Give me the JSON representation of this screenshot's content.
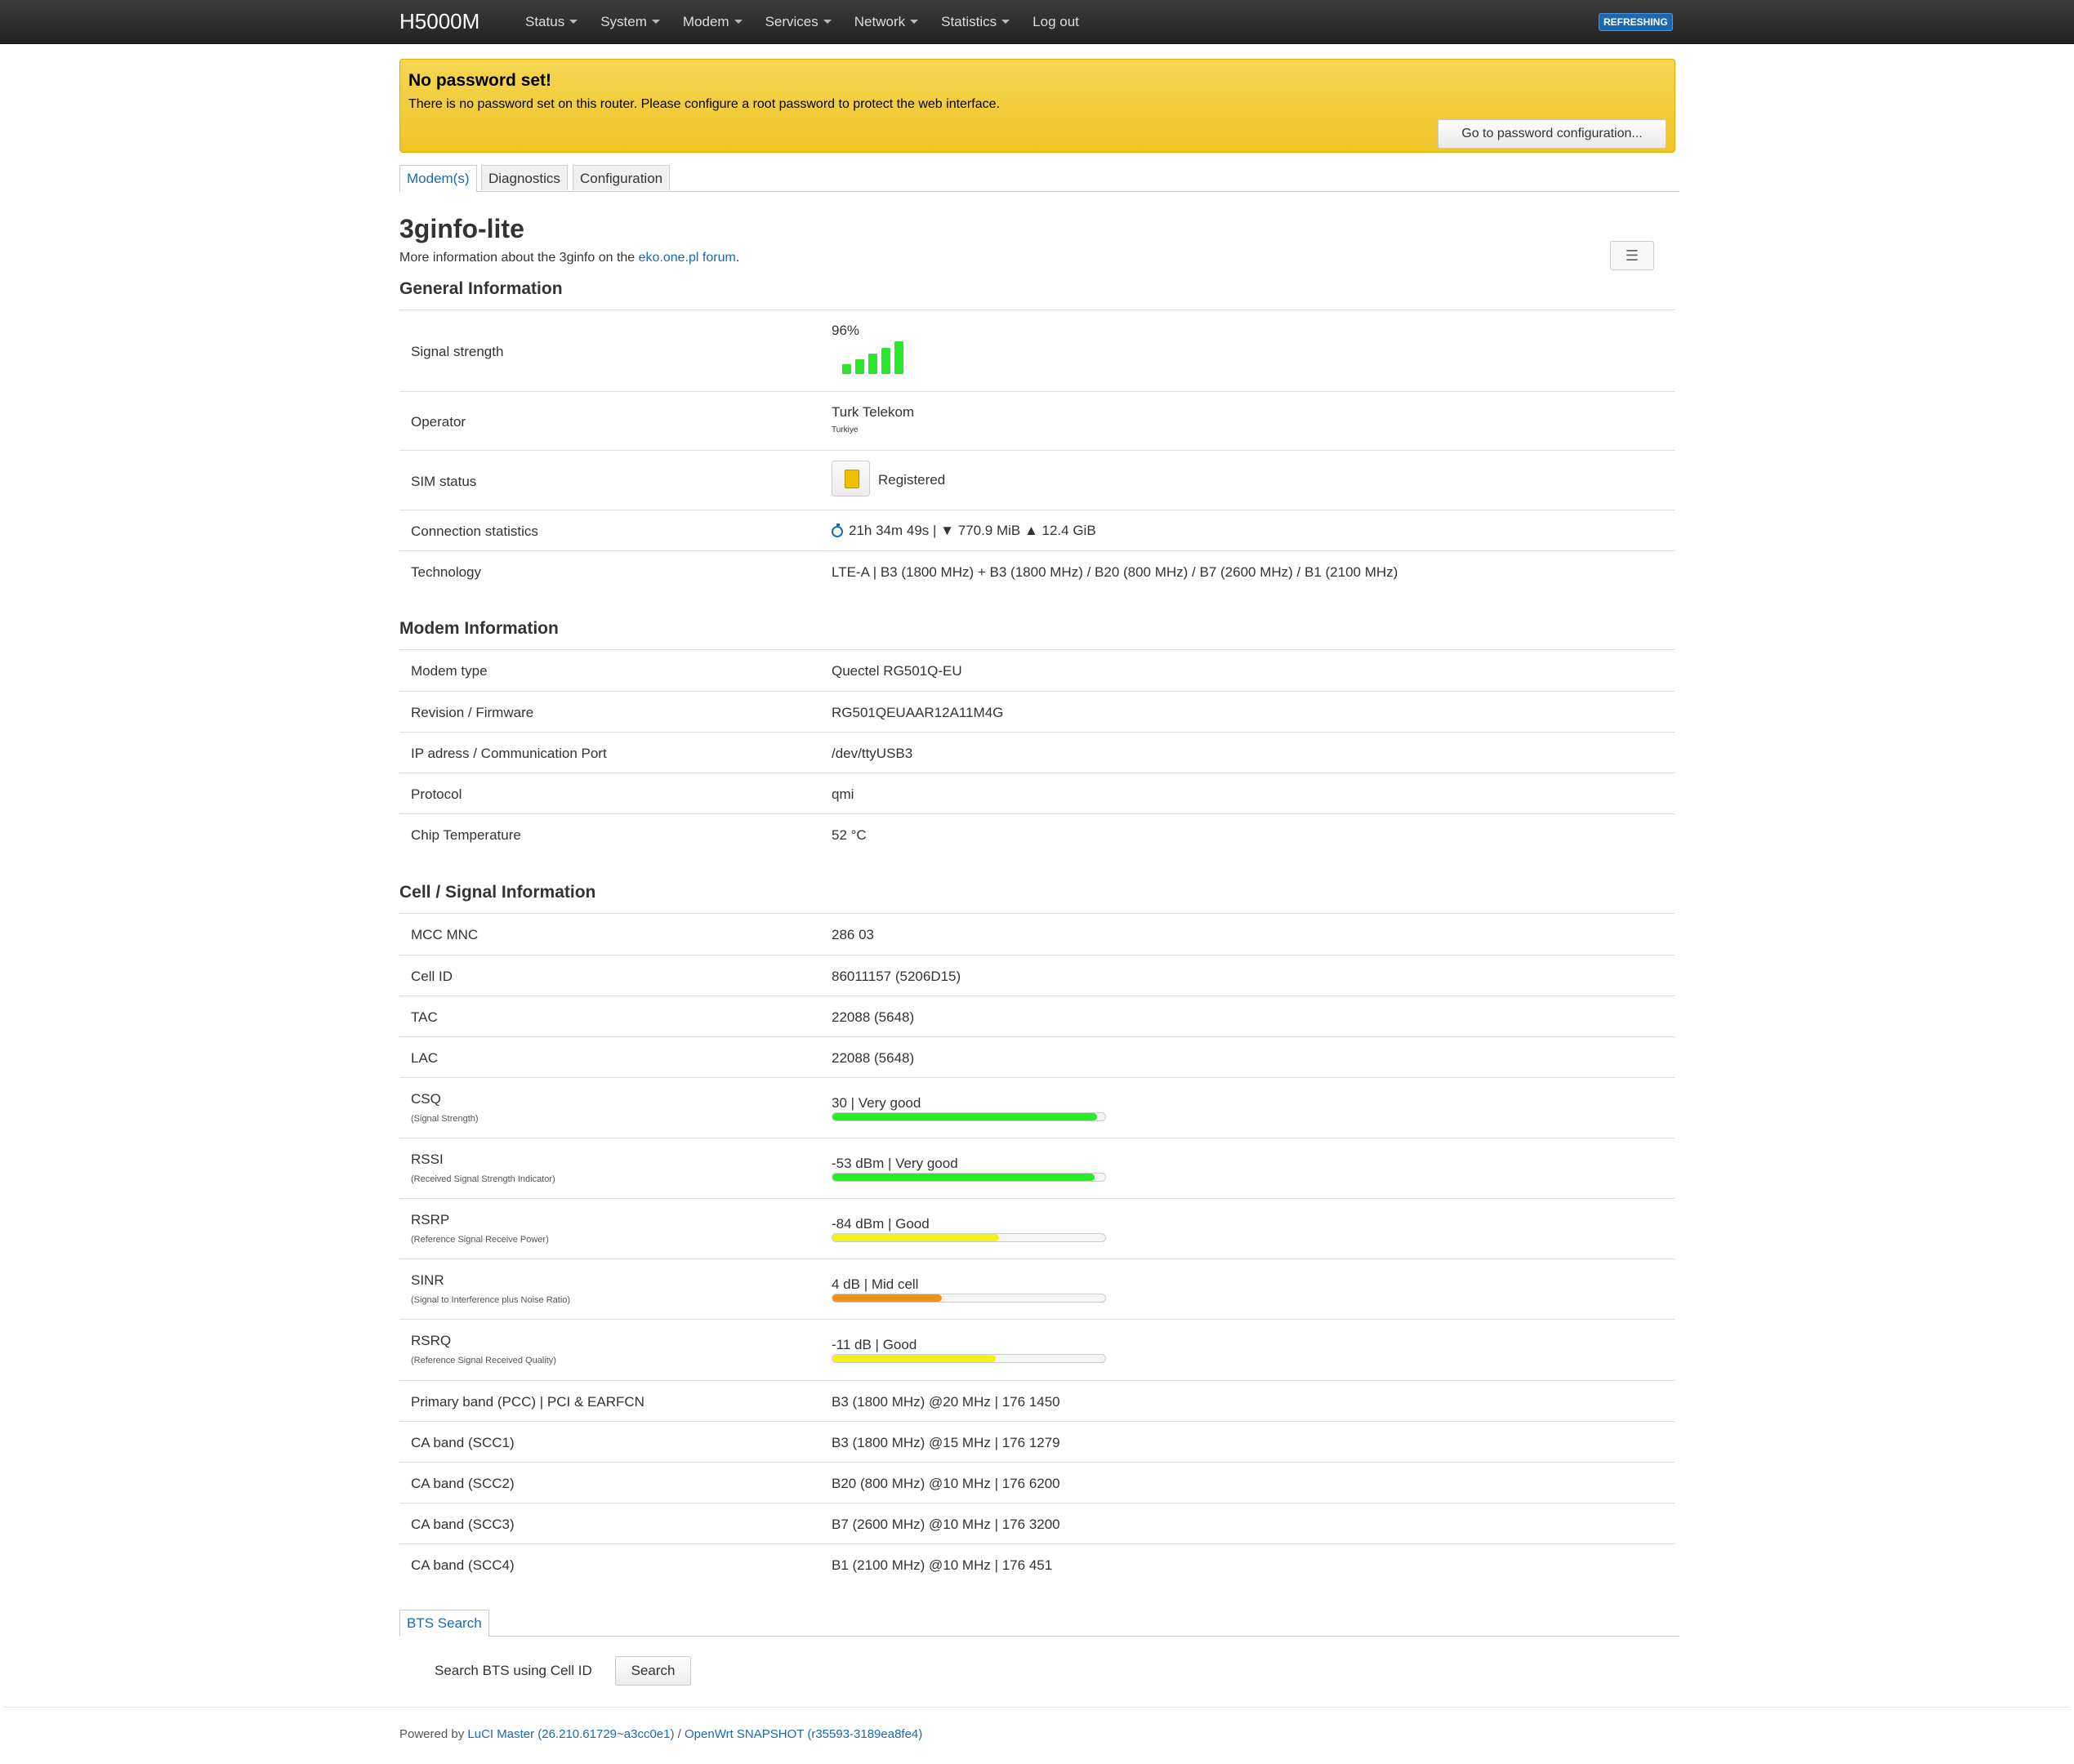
{
  "navbar": {
    "brand": "H5000M",
    "menu": [
      "Status",
      "System",
      "Modem",
      "Services",
      "Network",
      "Statistics",
      "Log out"
    ],
    "badge": "REFRESHING"
  },
  "alert": {
    "title": "No password set!",
    "text": "There is no password set on this router. Please configure a root password to protect the web interface.",
    "button": "Go to password configuration..."
  },
  "tabs": [
    "Modem(s)",
    "Diagnostics",
    "Configuration"
  ],
  "page": {
    "title": "3ginfo-lite",
    "intro_prefix": "More information about the 3ginfo on the ",
    "intro_link": "eko.one.pl forum",
    "intro_suffix": ".",
    "menu_icon": "☰"
  },
  "general": {
    "title": "General Information",
    "signal_label": "Signal strength",
    "signal_value": "96%",
    "signal_percent": 96,
    "operator_label": "Operator",
    "operator_value": "Turk Telekom",
    "operator_country": "Turkiye",
    "sim_label": "SIM status",
    "sim_value": "Registered",
    "conn_label": "Connection statistics",
    "conn_value": "21h 34m 49s | ▼ 770.9 MiB ▲ 12.4 GiB",
    "tech_label": "Technology",
    "tech_value": "LTE-A | B3 (1800 MHz) + B3 (1800 MHz) / B20 (800 MHz) / B7 (2600 MHz) / B1 (2100 MHz)"
  },
  "modem": {
    "title": "Modem Information",
    "rows": [
      {
        "label": "Modem type",
        "value": "Quectel RG501Q-EU"
      },
      {
        "label": "Revision / Firmware",
        "value": "RG501QEUAAR12A11M4G"
      },
      {
        "label": "IP adress / Communication Port",
        "value": "/dev/ttyUSB3"
      },
      {
        "label": "Protocol",
        "value": "qmi"
      },
      {
        "label": "Chip Temperature",
        "value": "52 °C"
      }
    ]
  },
  "cell": {
    "title": "Cell / Signal Information",
    "rows": [
      {
        "label": "MCC MNC",
        "value": "286 03"
      },
      {
        "label": "Cell ID",
        "value": "86011157 (5206D15)"
      },
      {
        "label": "TAC",
        "value": "22088 (5648)"
      },
      {
        "label": "LAC",
        "value": "22088 (5648)"
      }
    ],
    "meters": [
      {
        "label": "CSQ",
        "sub": "(Signal Strength)",
        "value": "30 | Very good",
        "percent": 97,
        "color": "#22ee22"
      },
      {
        "label": "RSSI",
        "sub": "(Received Signal Strength Indicator)",
        "value": "-53 dBm | Very good",
        "percent": 96,
        "color": "#22ee22"
      },
      {
        "label": "RSRP",
        "sub": "(Reference Signal Receive Power)",
        "value": "-84 dBm | Good",
        "percent": 61,
        "color": "#f2f21a"
      },
      {
        "label": "SINR",
        "sub": "(Signal to Interference plus Noise Ratio)",
        "value": "4 dB | Mid cell",
        "percent": 40,
        "color": "#f5900f"
      },
      {
        "label": "RSRQ",
        "sub": "(Reference Signal Received Quality)",
        "value": "-11 dB | Good",
        "percent": 60,
        "color": "#f2f21a"
      }
    ],
    "bands": [
      {
        "label": "Primary band (PCC) | PCI & EARFCN",
        "value": "B3 (1800 MHz) @20 MHz | 176 1450"
      },
      {
        "label": "CA band (SCC1)",
        "value": "B3 (1800 MHz) @15 MHz | 176 1279"
      },
      {
        "label": "CA band (SCC2)",
        "value": "B20 (800 MHz) @10 MHz | 176 6200"
      },
      {
        "label": "CA band (SCC3)",
        "value": "B7 (2600 MHz) @10 MHz | 176 3200"
      },
      {
        "label": "CA band (SCC4)",
        "value": "B1 (2100 MHz) @10 MHz | 176 451"
      }
    ]
  },
  "bts": {
    "tab": "BTS Search",
    "label": "Search BTS using Cell ID",
    "button": "Search"
  },
  "footer": {
    "prefix": "Powered by ",
    "luci": "LuCI Master (26.210.61729~a3cc0e1)",
    "sep": " / ",
    "openwrt": "OpenWrt SNAPSHOT (r35593-3189ea8fe4)"
  }
}
